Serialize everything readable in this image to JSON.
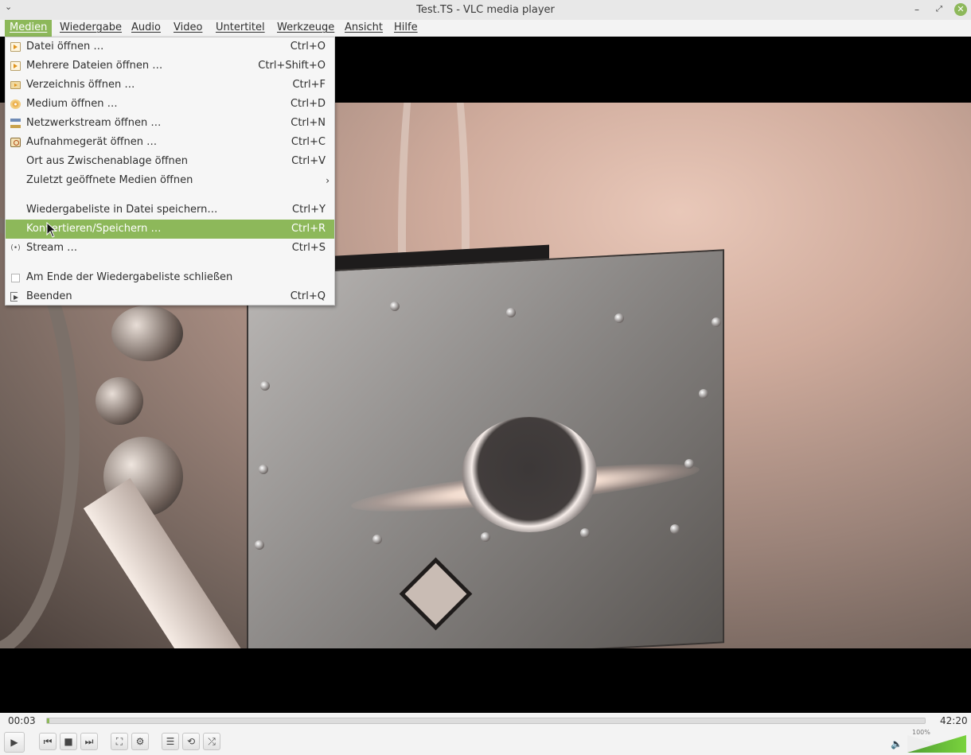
{
  "window": {
    "title": "Test.TS - VLC media player",
    "menu_glyph": "⌄",
    "minimize_glyph": "–",
    "maximize_glyph": "⤢",
    "close_glyph": "✕"
  },
  "menubar": {
    "items": [
      {
        "label": "Medien"
      },
      {
        "label": "Wiedergabe"
      },
      {
        "label": "Audio"
      },
      {
        "label": "Video"
      },
      {
        "label": "Untertitel"
      },
      {
        "label": "Werkzeuge"
      },
      {
        "label": "Ansicht"
      },
      {
        "label": "Hilfe"
      }
    ],
    "active_color": "#8db85a"
  },
  "media_menu": {
    "items": [
      {
        "label": "Datei öffnen …",
        "shortcut": "Ctrl+O",
        "icon": "file-open-icon"
      },
      {
        "label": "Mehrere Dateien öffnen …",
        "shortcut": "Ctrl+Shift+O",
        "icon": "files-open-icon"
      },
      {
        "label": "Verzeichnis öffnen …",
        "shortcut": "Ctrl+F",
        "icon": "folder-icon"
      },
      {
        "label": "Medium öffnen …",
        "shortcut": "Ctrl+D",
        "icon": "disc-icon"
      },
      {
        "label": "Netzwerkstream öffnen …",
        "shortcut": "Ctrl+N",
        "icon": "network-icon"
      },
      {
        "label": "Aufnahmegerät öffnen …",
        "shortcut": "Ctrl+C",
        "icon": "capture-device-icon"
      },
      {
        "label": "Ort aus Zwischenablage öffnen",
        "shortcut": "Ctrl+V"
      },
      {
        "label": "Zuletzt geöffnete Medien öffnen",
        "submenu_arrow": "›"
      },
      {
        "label": "Wiedergabeliste in Datei speichern…",
        "shortcut": "Ctrl+Y"
      },
      {
        "label": "Konvertieren/Speichern …",
        "shortcut": "Ctrl+R",
        "highlighted": true
      },
      {
        "label": "Stream …",
        "shortcut": "Ctrl+S",
        "icon": "stream-icon"
      },
      {
        "label": "Am Ende der Wiedergabeliste schließen",
        "checkbox": false
      },
      {
        "label": "Beenden",
        "shortcut": "Ctrl+Q",
        "icon": "quit-icon"
      }
    ],
    "highlight_color": "#8db85a"
  },
  "player": {
    "elapsed": "00:03",
    "total": "42:20",
    "progress_fraction": 0.0012,
    "volume_label": "100%",
    "volume_fraction": 1.0
  },
  "controls": {
    "play_glyph": "▶",
    "prev_glyph": "⏮",
    "stop_glyph": "■",
    "next_glyph": "⏭",
    "fullscreen_glyph": "⛶",
    "settings_glyph": "⚙",
    "playlist_glyph": "☰",
    "loop_glyph": "⟲",
    "shuffle_glyph": "⤮",
    "speaker_glyph": "🔈"
  }
}
